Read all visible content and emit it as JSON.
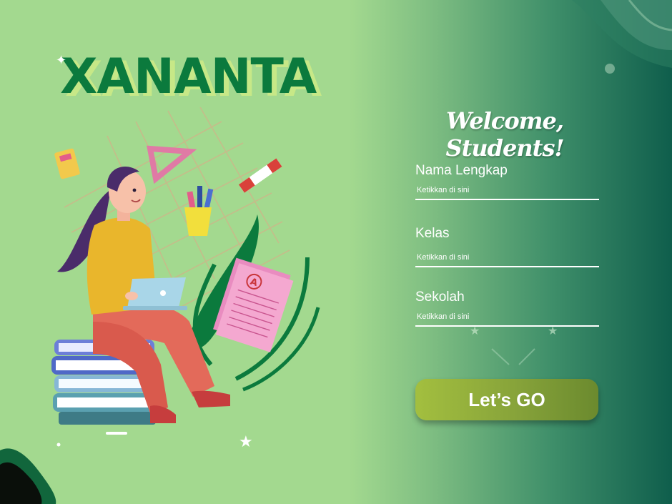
{
  "brand": {
    "logo_text": "XANANTA"
  },
  "login": {
    "welcome": "Welcome, Students!",
    "fields": [
      {
        "label": "Nama Lengkap",
        "placeholder": "Ketikkan di sini"
      },
      {
        "label": "Kelas",
        "placeholder": "Ketikkan di sini"
      },
      {
        "label": "Sekolah",
        "placeholder": "Ketikkan di sini"
      }
    ],
    "submit_label": "Let’s GO"
  },
  "illustration": {
    "paper_grade": "A"
  },
  "colors": {
    "background_light": "#a3d98f",
    "background_dark": "#0f5e4c",
    "brand_green": "#0b7a3d",
    "button": "#87a33a"
  }
}
